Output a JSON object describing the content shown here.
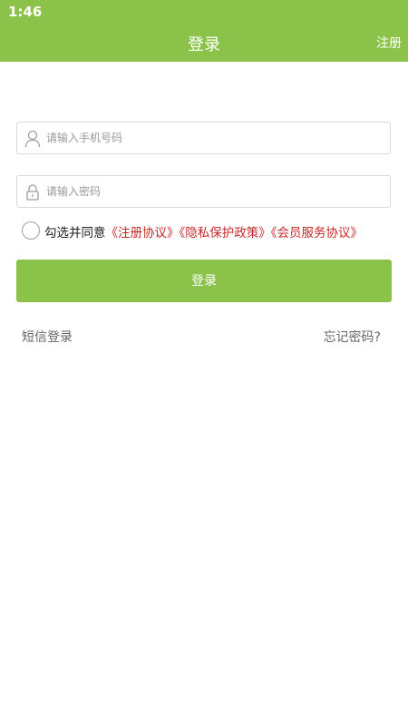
{
  "status_bar": {
    "time": "1:46"
  },
  "header": {
    "title": "登录",
    "register_label": "注册",
    "background_color": "#8bc34a"
  },
  "form": {
    "phone": {
      "placeholder": "请输入手机号码",
      "icon": "user-icon"
    },
    "password": {
      "placeholder": "请输入密码",
      "icon": "lock-icon"
    },
    "agreement": {
      "checked": false,
      "prefix": "勾选并同意",
      "links": [
        "《注册协议》",
        "《隐私保护政策》",
        "《会员服务协议》"
      ],
      "link_color": "#c62828"
    },
    "submit_label": "登录"
  },
  "footer_links": {
    "sms_login": "短信登录",
    "forgot_password": "忘记密码?"
  }
}
